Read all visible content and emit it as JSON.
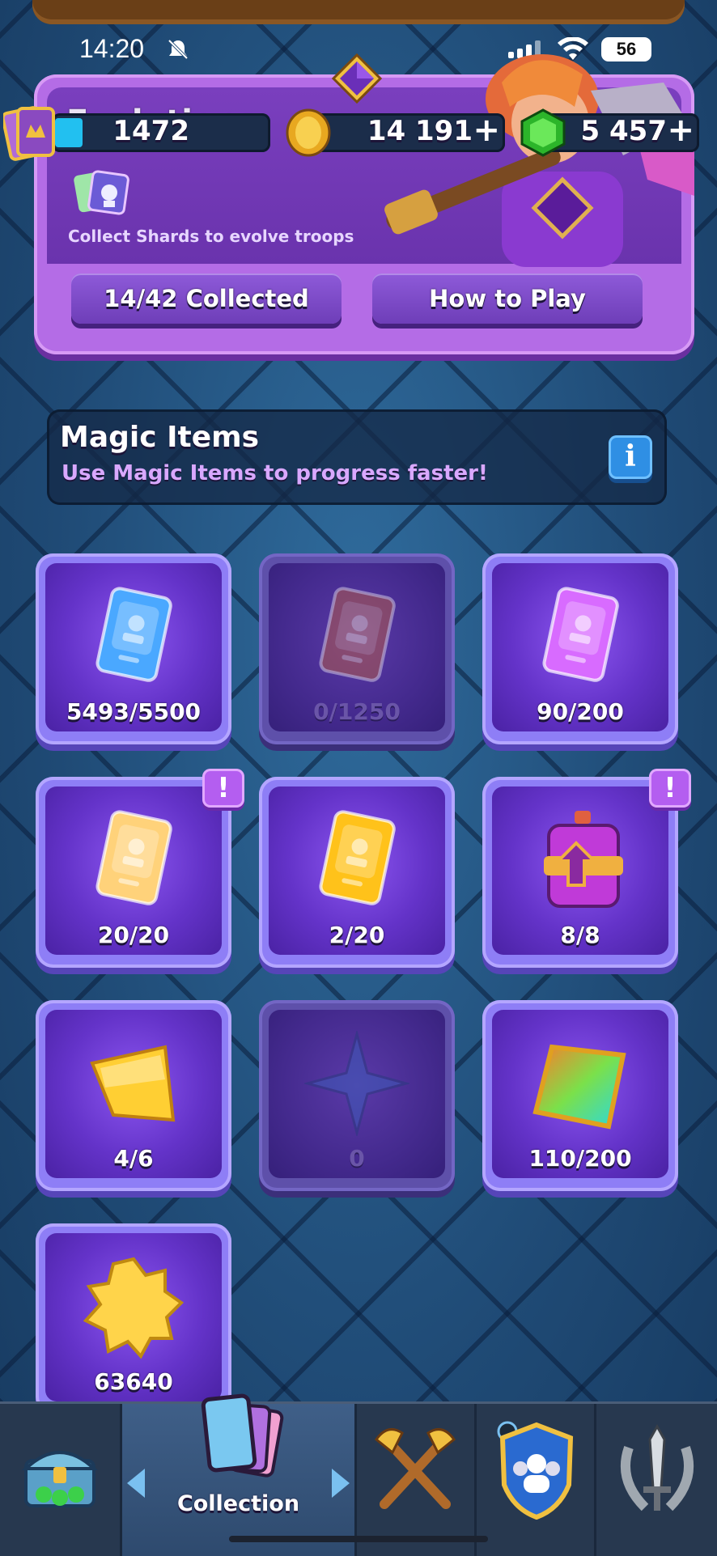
{
  "status_bar": {
    "time": "14:20",
    "battery": "56"
  },
  "evolutions": {
    "title": "Evolutions",
    "subtitle": "Collect Shards to evolve troops",
    "collected_button": "14/42 Collected",
    "how_to_play_button": "How to Play"
  },
  "currencies": {
    "trophies": "1472",
    "gold": "14 191",
    "gems": "5 457",
    "plus": "+"
  },
  "magic_items": {
    "title": "Magic Items",
    "subtitle": "Use Magic Items to progress faster!",
    "info": "i",
    "items": [
      {
        "icon": "common-wild-card-icon",
        "count": "5493/5500",
        "color": "#4aa8ff"
      },
      {
        "icon": "rare-wild-card-icon",
        "count": "0/1250",
        "color": "#b05a4a"
      },
      {
        "icon": "epic-wild-card-icon",
        "count": "90/200",
        "color": "#d86bff"
      },
      {
        "icon": "legendary-wild-card-icon",
        "count": "20/20",
        "color": "#ffd27a",
        "alert": "!"
      },
      {
        "icon": "champion-wild-card-icon",
        "count": "2/20",
        "color": "#ffc21a"
      },
      {
        "icon": "elixir-potion-icon",
        "count": "8/8",
        "color": "#c03ad8",
        "alert": "!"
      },
      {
        "icon": "gold-shard-icon",
        "count": "4/6",
        "color": "#ffcf33"
      },
      {
        "icon": "star-shard-icon",
        "count": "0",
        "color": "#3d5bb8"
      },
      {
        "icon": "rainbow-shard-icon",
        "count": "110/200",
        "color": "#7be04a"
      },
      {
        "icon": "star-points-icon",
        "count": "63640",
        "color": "#ffd44a"
      }
    ]
  },
  "nav": {
    "active_label": "Collection",
    "items": [
      "shop-tab",
      "collection-tab",
      "battle-tab",
      "clan-tab",
      "events-tab"
    ]
  },
  "colors": {
    "panel_purple": "#b46ce6",
    "card_violet": "#8e7ef6",
    "background_blue": "#234d78"
  }
}
